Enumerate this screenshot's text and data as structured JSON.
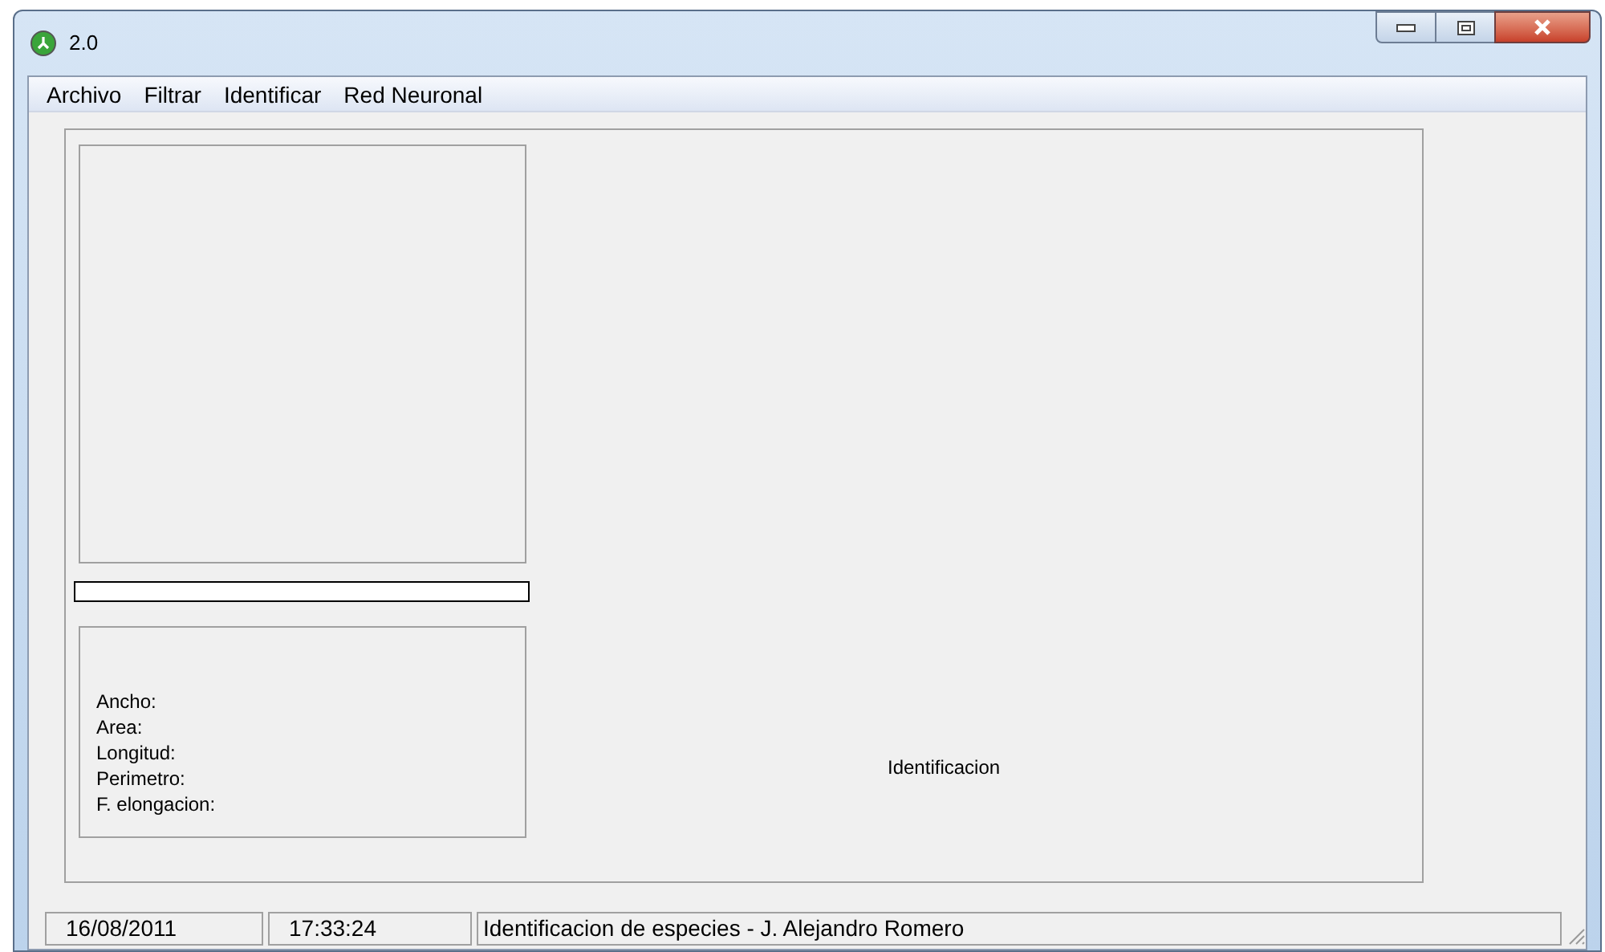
{
  "window": {
    "title": "2.0"
  },
  "menu": [
    "Archivo",
    "Filtrar",
    "Identificar",
    "Red Neuronal"
  ],
  "progress": {
    "level": 0
  },
  "measurements": [
    "Ancho:",
    "Area:",
    "Longitud:",
    "Perimetro:",
    "F. elongacion:"
  ],
  "result_label": "Identificacion",
  "status_bar": [
    "16/08/2011",
    "17:33:24",
    "Identificacion de especies - J. Alejandro Romero"
  ]
}
